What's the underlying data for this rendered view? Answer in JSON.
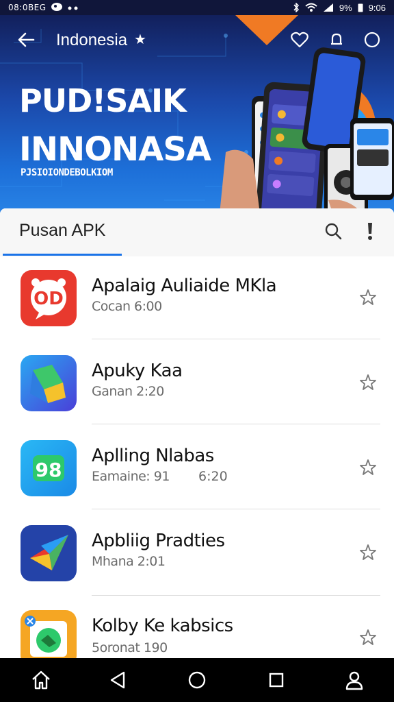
{
  "status_bar": {
    "left_text": "08:0BEG",
    "battery": "9%",
    "time": "9:06"
  },
  "toolbar": {
    "region_title": "Indonesia",
    "icons": [
      "back-arrow-icon",
      "heart-icon",
      "bell-icon",
      "circle-icon"
    ]
  },
  "banner": {
    "title_line1": "PUD!SAIK",
    "title_line2": "INNONASA",
    "subtitle": "PJSIOIONDEBOLKIOM"
  },
  "search": {
    "label": "Pusan APK"
  },
  "apps": [
    {
      "name": "Apalaig Auliaide MKla",
      "meta": "Cocan 6:00",
      "meta_extra": "",
      "icon_text": "OD"
    },
    {
      "name": "Apuky Kaa",
      "meta": "Ganan 2:20",
      "meta_extra": "",
      "icon_text": ""
    },
    {
      "name": "Aplling Nlabas",
      "meta": "Eamaine: 91",
      "meta_extra": "6:20",
      "icon_text": "98"
    },
    {
      "name": "Apbliig Pradties",
      "meta": "Mhana 2:01",
      "meta_extra": "",
      "icon_text": ""
    },
    {
      "name": "Kolby Ke kabsics",
      "meta": "5oronat 190",
      "meta_extra": "",
      "icon_text": ""
    }
  ],
  "colors": {
    "accent": "#1a73e8",
    "banner_dark": "#12205c",
    "banner_light": "#2a86e8",
    "orange_accent": "#f07a24",
    "nav_bar": "#000000"
  }
}
